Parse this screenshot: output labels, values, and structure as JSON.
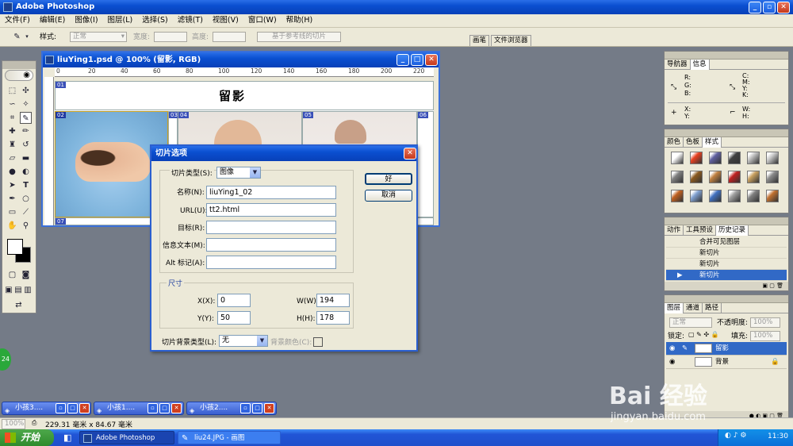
{
  "app": {
    "title": "Adobe Photoshop"
  },
  "menu": [
    "文件(F)",
    "编辑(E)",
    "图像(I)",
    "图层(L)",
    "选择(S)",
    "滤镜(T)",
    "视图(V)",
    "窗口(W)",
    "帮助(H)"
  ],
  "options": {
    "style_label": "样式:",
    "style_value": "正常",
    "width_label": "宽度:",
    "height_label": "高度:",
    "guides_button": "基于参考线的切片",
    "tab_brushes": "画笔",
    "tab_filebrowser": "文件浏览器"
  },
  "document": {
    "title": "liuYing1.psd @ 100% (留影, RGB)",
    "heading": "留影",
    "ruler_marks": [
      "0",
      "20",
      "40",
      "60",
      "80",
      "100",
      "120",
      "140",
      "160",
      "180",
      "200",
      "220"
    ],
    "slice_labels": [
      "01",
      "02",
      "03",
      "04",
      "05",
      "06",
      "07"
    ]
  },
  "dialog": {
    "title": "切片选项",
    "slice_type_label": "切片类型(S):",
    "slice_type_value": "图像",
    "name_label": "名称(N):",
    "name_value": "liuYing1_02",
    "url_label": "URL(U):",
    "url_value": "tt2.html",
    "target_label": "目标(R):",
    "target_value": "",
    "message_label": "信息文本(M):",
    "message_value": "",
    "alt_label": "Alt 标记(A):",
    "alt_value": "",
    "dimensions_title": "尺寸",
    "x_label": "X(X):",
    "x_value": "0",
    "y_label": "Y(Y):",
    "y_value": "50",
    "w_label": "W(W):",
    "w_value": "194",
    "h_label": "H(H):",
    "h_value": "178",
    "bg_type_label": "切片背景类型(L):",
    "bg_type_value": "无",
    "bg_color_label": "背景颜色(C):",
    "ok_button": "好",
    "cancel_button": "取消"
  },
  "navigator_panel": {
    "tabs": [
      "导航器",
      "信息"
    ],
    "rgb": "R:\nG:\nB:",
    "cmyk": "C:\nM:\nY:\nK:",
    "xy": "X:\nY:",
    "wh": "W:\nH:"
  },
  "color_panel": {
    "tabs": [
      "颜色",
      "色板",
      "样式"
    ],
    "swatches": [
      "#ffffff",
      "#e84020",
      "#6060a0",
      "#404040",
      "#c0c0c0",
      "#c8c8c8",
      "#808080",
      "#8b5a20",
      "#c08040",
      "#c02020",
      "#c8a060",
      "#8a8a8a",
      "#c06020",
      "#80a0d0",
      "#4070c0",
      "#a0a0a0",
      "#808080",
      "#c07030"
    ]
  },
  "history_panel": {
    "tabs": [
      "动作",
      "工具预设",
      "历史记录"
    ],
    "items": [
      "合并可见图层",
      "新切片",
      "新切片",
      "新切片"
    ]
  },
  "layers_panel": {
    "tabs": [
      "图层",
      "通道",
      "路径"
    ],
    "blend_mode": "正常",
    "opacity_label": "不透明度:",
    "opacity_value": "100%",
    "lock_label": "锁定:",
    "fill_label": "填充:",
    "fill_value": "100%",
    "layers": [
      "留影",
      "背景"
    ]
  },
  "minimized": [
    "小孩3....",
    "小孩1....",
    "小孩2...."
  ],
  "status": {
    "zoom": "100%",
    "size": "229.31 毫米 x 84.67 毫米"
  },
  "taskbar": {
    "start": "开始",
    "tasks": [
      "Adobe Photoshop",
      "liu24.JPG - 画图"
    ],
    "clock": "11:30"
  },
  "watermark": {
    "logo": "Bai 经验",
    "url": "jingyan.baidu.com"
  },
  "badge": "24"
}
